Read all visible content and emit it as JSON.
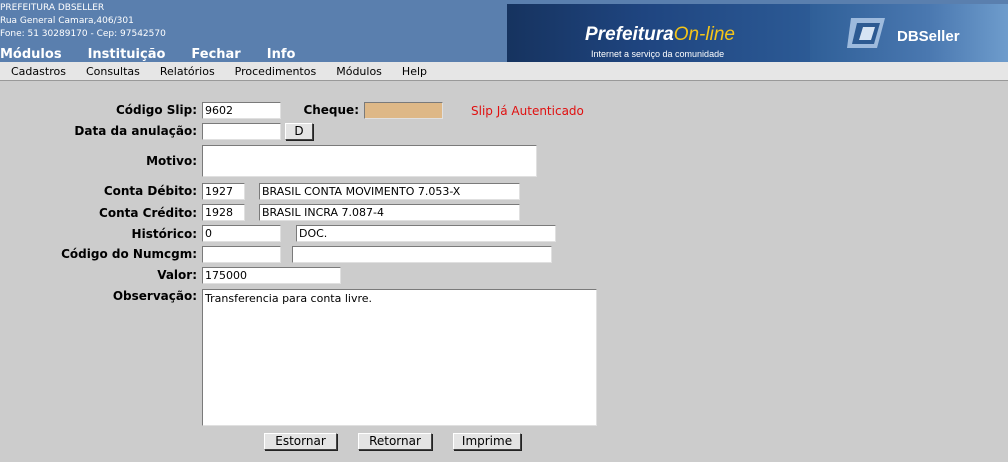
{
  "header": {
    "org_name": "PREFEITURA DBSELLER",
    "address": "Rua General Camara,406/301",
    "phone_line": "Fone: 51 30289170  -  Cep: 97542570",
    "nav": [
      "Módulos",
      "Instituição",
      "Fechar",
      "Info"
    ],
    "banner_title_main": "Prefeitura",
    "banner_title_accent": "On-line",
    "banner_subtitle": "Internet a serviço da comunidade",
    "brand": "DBSeller"
  },
  "menubar": [
    "Cadastros",
    "Consultas",
    "Relatórios",
    "Procedimentos",
    "Módulos",
    "Help"
  ],
  "form": {
    "codigo_slip": {
      "label": "Código Slip:",
      "value": "9602"
    },
    "cheque": {
      "label": "Cheque:",
      "value": ""
    },
    "status_message": "Slip Já Autenticado",
    "data_anulacao": {
      "label": "Data da anulação:",
      "value": "",
      "button": "D"
    },
    "motivo": {
      "label": "Motivo:",
      "value": ""
    },
    "conta_debito": {
      "label": "Conta Débito:",
      "code": "1927",
      "description": "BRASIL CONTA MOVIMENTO 7.053-X"
    },
    "conta_credito": {
      "label": "Conta Crédito:",
      "code": "1928",
      "description": "BRASIL INCRA 7.087-4"
    },
    "historico": {
      "label": "Histórico:",
      "code": "0",
      "description": "DOC."
    },
    "codigo_numcgm": {
      "label": "Código do Numcgm:",
      "code": "",
      "description": ""
    },
    "valor": {
      "label": "Valor:",
      "value": "175000"
    },
    "observacao": {
      "label": "Observação:",
      "value": "Transferencia para conta livre."
    }
  },
  "buttons": {
    "estornar": "Estornar",
    "retornar": "Retornar",
    "imprime": "Imprime"
  },
  "colors": {
    "header_bg": "#5a7fae",
    "page_bg": "#cccccc",
    "cheque_bg": "#deb887",
    "warning": "#e01010"
  }
}
